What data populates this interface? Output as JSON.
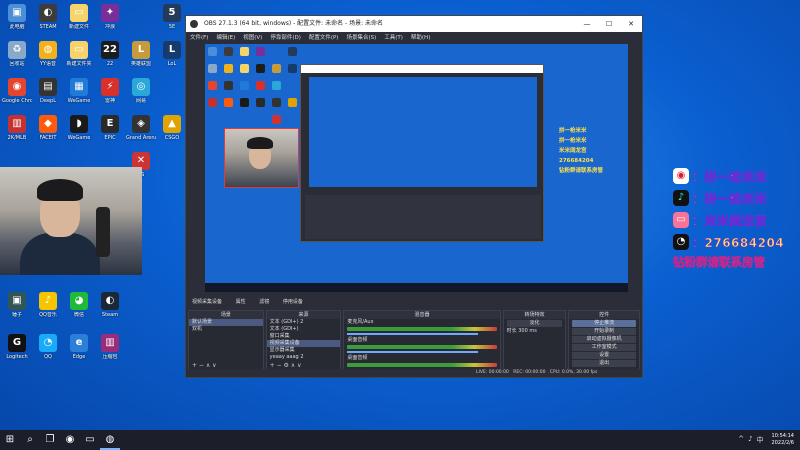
{
  "desktop_icons": [
    {
      "label": "此电脑",
      "glyph": "▣",
      "color": "#4a8fd8",
      "col": 0,
      "row": 0
    },
    {
      "label": "回收站",
      "glyph": "♻",
      "color": "#8aa9c8",
      "col": 0,
      "row": 1
    },
    {
      "label": "Google Chrome",
      "glyph": "◉",
      "color": "#e4452f",
      "col": 0,
      "row": 2
    },
    {
      "label": "2K/MLB",
      "glyph": "▥",
      "color": "#c43131",
      "col": 0,
      "row": 3
    },
    {
      "label": "STEAM",
      "glyph": "◐",
      "color": "#3c3c3c",
      "col": 1,
      "row": 0
    },
    {
      "label": "YY语音",
      "glyph": "◍",
      "color": "#f2b11a",
      "col": 1,
      "row": 1
    },
    {
      "label": "DeepL",
      "glyph": "▤",
      "color": "#333",
      "col": 1,
      "row": 2
    },
    {
      "label": "FACEIT",
      "glyph": "◆",
      "color": "#ff5b0a",
      "col": 1,
      "row": 3
    },
    {
      "label": "新建文件",
      "glyph": "▭",
      "color": "#f6d36b",
      "col": 2,
      "row": 0
    },
    {
      "label": "新建文件夹",
      "glyph": "▭",
      "color": "#f6d36b",
      "col": 2,
      "row": 1
    },
    {
      "label": "WeGame",
      "glyph": "▦",
      "color": "#1f7bd7",
      "col": 2,
      "row": 2
    },
    {
      "label": "WeGame",
      "glyph": "◗",
      "color": "#1a1a1a",
      "col": 2,
      "row": 3
    },
    {
      "label": "冲浪",
      "glyph": "✦",
      "color": "#7a2e9a",
      "col": 3,
      "row": 0
    },
    {
      "label": "22",
      "glyph": "22",
      "color": "#1c1c1c",
      "col": 3,
      "row": 1
    },
    {
      "label": "雷神",
      "glyph": "⚡",
      "color": "#d9302c",
      "col": 3,
      "row": 2
    },
    {
      "label": "EPIC",
      "glyph": "E",
      "color": "#2a2a2a",
      "col": 3,
      "row": 3
    },
    {
      "label": "英雄联盟",
      "glyph": "L",
      "color": "#c79a3c",
      "col": 4,
      "row": 1
    },
    {
      "label": "网易",
      "glyph": "◎",
      "color": "#2aa8d8",
      "col": 4,
      "row": 2
    },
    {
      "label": "Grand Arena",
      "glyph": "◈",
      "color": "#333",
      "col": 4,
      "row": 3
    },
    {
      "label": "5E",
      "glyph": "5",
      "color": "#233b5a",
      "col": 5,
      "row": 0
    },
    {
      "label": "LoL",
      "glyph": "L",
      "color": "#173b6a",
      "col": 5,
      "row": 1
    },
    {
      "label": "CSGO",
      "glyph": "▲",
      "color": "#e0a400",
      "col": 5,
      "row": 3
    },
    {
      "label": "CS",
      "glyph": "✕",
      "color": "#c33",
      "col": 4,
      "row": 4
    }
  ],
  "desktop_icons_lower": [
    {
      "label": "锤子",
      "glyph": "▣",
      "color": "#355"
    },
    {
      "label": "QQ音乐",
      "glyph": "♪",
      "color": "#f6c500"
    },
    {
      "label": "微信",
      "glyph": "◕",
      "color": "#1fba3a"
    },
    {
      "label": "Steam",
      "glyph": "◐",
      "color": "#1b2838"
    },
    {
      "label": "Logitech",
      "glyph": "G",
      "color": "#111"
    },
    {
      "label": "QQ",
      "glyph": "◔",
      "color": "#19aaf8"
    },
    {
      "label": "Edge",
      "glyph": "e",
      "color": "#2b7fd9"
    },
    {
      "label": "压缩包",
      "glyph": "▥",
      "color": "#9a2d7a"
    }
  ],
  "obs": {
    "title": "OBS 27.1.3 (64 bit, windows) - 配置文件: 未命名 - 场景: 未命名",
    "menu": [
      "文件(F)",
      "编辑(E)",
      "视图(V)",
      "停靠部件(D)",
      "配置文件(P)",
      "场景集合(S)",
      "工具(T)",
      "帮助(H)"
    ],
    "source_bar": {
      "source": "视频采集设备",
      "props": "属性",
      "filters": "滤镜",
      "deactivate": "停用设备"
    },
    "docks": {
      "scenes": {
        "title": "场景",
        "items": [
          "默认场景",
          "双机"
        ]
      },
      "sources": {
        "title": "来源",
        "items": [
          "文本 (GDI+) 2",
          "文本 (GDI+)",
          "窗口采集",
          "视频采集设备",
          "显示器采集",
          "yeaay aaag 2"
        ]
      },
      "mixer": {
        "title": "混音器",
        "channels": [
          {
            "name": "麦克风/Aux"
          },
          {
            "name": "桌面音频"
          },
          {
            "name": "桌面音频"
          }
        ]
      },
      "transitions": {
        "title": "转场特效",
        "type": "淡化",
        "duration_label": "时长",
        "duration": "300 ms"
      },
      "controls": {
        "title": "控件",
        "buttons": [
          "停止推流",
          "开始录制",
          "启动虚拟摄像机",
          "工作室模式",
          "设置",
          "退出"
        ]
      }
    },
    "status": {
      "live": "LIVE: 00:00:00",
      "rec": "REC: 00:00:00",
      "cpu": "CPU: 0.0%, 30.00 fps"
    },
    "mini_overlay": [
      "拼一枪米米",
      "拼一枪米米",
      "米米阔龙宫",
      "276684204",
      "钻粉群请联系房管"
    ]
  },
  "overlay": {
    "rows": [
      {
        "icon": "weibo-icon",
        "glyph": "◉",
        "bg": "#ffffff",
        "fg": "#e6162d",
        "text": "：拼一枪米米"
      },
      {
        "icon": "tiktok-icon",
        "glyph": "♪",
        "bg": "#111111",
        "fg": "#25f4ee",
        "text": "：拼一枪米米"
      },
      {
        "icon": "bilibili-icon",
        "glyph": "▭",
        "bg": "#fb7299",
        "fg": "#ffffff",
        "text": "：米米阔龙宫"
      },
      {
        "icon": "qq-icon",
        "glyph": "◔",
        "bg": "#111111",
        "fg": "#ffffff",
        "text": "：276684204"
      }
    ],
    "footer": "钻粉群请联系房管"
  },
  "taskbar": {
    "apps": [
      "windows-start-icon",
      "search-icon",
      "task-view-icon",
      "chrome-icon",
      "folder-icon",
      "obs-icon"
    ],
    "glyphs": [
      "⊞",
      "⌕",
      "❐",
      "◉",
      "▭",
      "◍"
    ],
    "time": "10:54:14",
    "date": "2022/2/6",
    "tray": [
      "^",
      "♪",
      "中"
    ]
  }
}
